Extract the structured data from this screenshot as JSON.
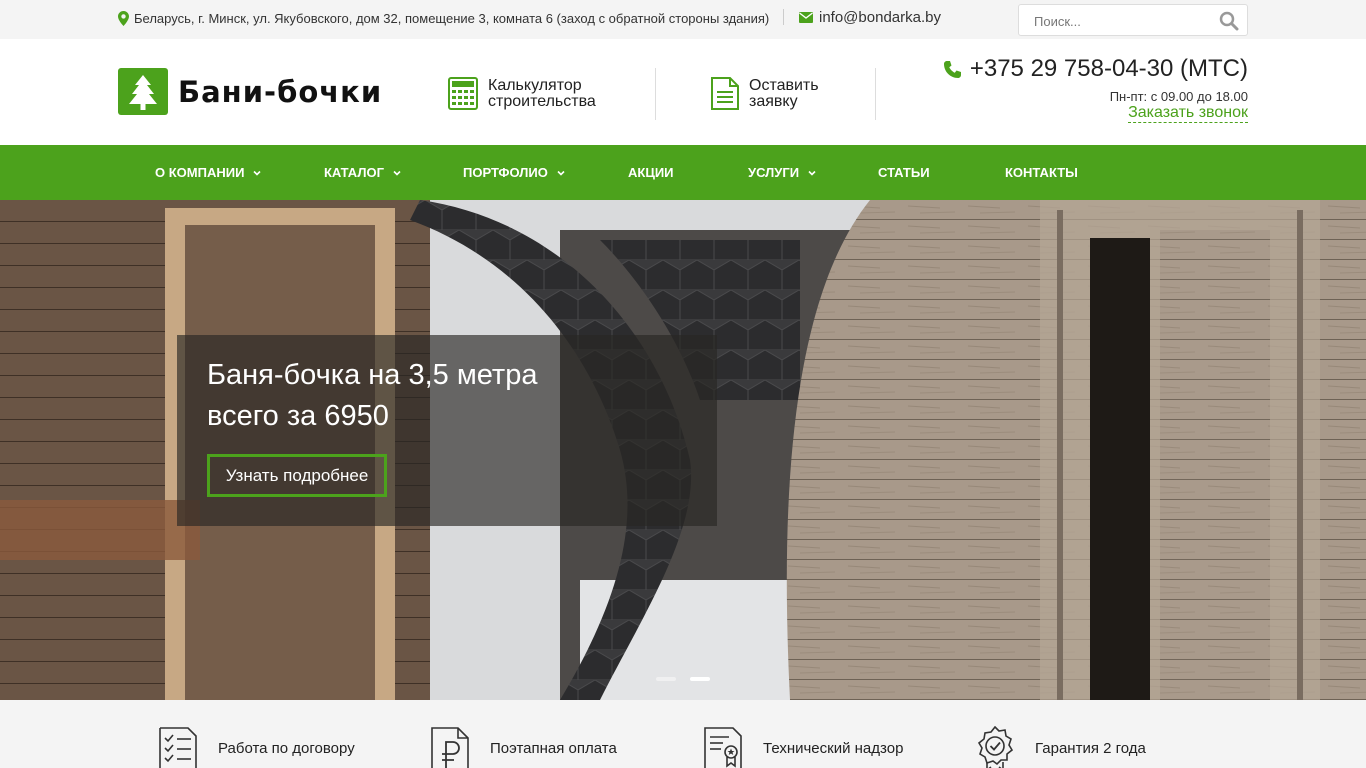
{
  "topbar": {
    "address": "Беларусь, г. Минск, ул. Якубовского, дом 32, помещение 3, комната 6 (заход с обратной стороны здания)",
    "email": "info@bondarka.by",
    "search_placeholder": "Поиск...",
    "icons": [
      "map-marker-icon",
      "envelope-icon",
      "search-icon"
    ]
  },
  "header": {
    "logo_text": "Бани-бочки",
    "calculator_label_1": "Калькулятор",
    "calculator_label_2": "строительства",
    "request_label_1": "Оставить",
    "request_label_2": "заявку",
    "phone": "+375 29 758-04-30 (МТС)",
    "hours": "Пн-пт: с 09.00 до 18.00",
    "callback": "Заказать звонок"
  },
  "nav": {
    "items": [
      {
        "label": "О КОМПАНИИ",
        "has_dropdown": true
      },
      {
        "label": "КАТАЛОГ",
        "has_dropdown": true
      },
      {
        "label": "ПОРТФОЛИО",
        "has_dropdown": true
      },
      {
        "label": "АКЦИИ",
        "has_dropdown": false
      },
      {
        "label": "УСЛУГИ",
        "has_dropdown": true
      },
      {
        "label": "СТАТЬИ",
        "has_dropdown": false
      },
      {
        "label": "КОНТАКТЫ",
        "has_dropdown": false
      }
    ]
  },
  "hero": {
    "title_line_1": "Баня-бочка на 3,5 метра",
    "title_line_2": "всего за 6950",
    "button_label": "Узнать подробнее",
    "slide_count": 2,
    "active_slide": 2
  },
  "features": [
    {
      "label": "Работа по договору",
      "icon": "contract-checklist-icon"
    },
    {
      "label": "Поэтапная оплата",
      "icon": "ruble-document-icon"
    },
    {
      "label": "Технический надзор",
      "icon": "certificate-icon"
    },
    {
      "label": "Гарантия 2 года",
      "icon": "warranty-badge-icon"
    }
  ],
  "colors": {
    "accent": "#4ca21c",
    "topbar_bg": "#f4f4f4",
    "text": "#222222"
  }
}
